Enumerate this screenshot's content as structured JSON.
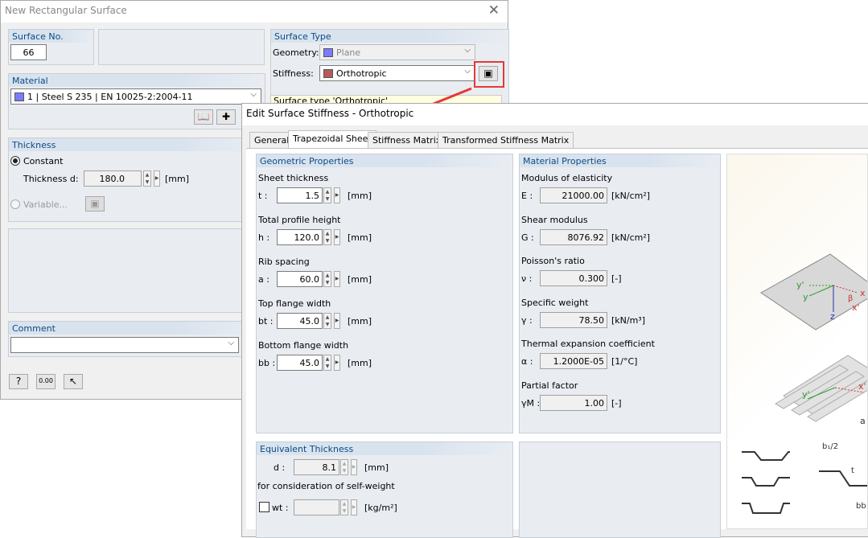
{
  "back": {
    "title": "New Rectangular Surface",
    "surface_no_label": "Surface No.",
    "surface_no": "66",
    "surface_type_label": "Surface Type",
    "geometry_label": "Geometry:",
    "geometry_value": "Plane",
    "stiffness_label": "Stiffness:",
    "stiffness_value": "Orthotropic",
    "info": "Surface type 'Orthotropic'",
    "material_label": "Material",
    "material_value": "1   |  Steel S 235  |  EN 10025-2:2004-11",
    "thickness_label": "Thickness",
    "constant_label": "Constant",
    "thickness_d_label": "Thickness d:",
    "thickness_d": "180.0",
    "thickness_unit": "[mm]",
    "variable_label": "Variable...",
    "comment_label": "Comment",
    "zero_btn": "0.00"
  },
  "front": {
    "title": "Edit Surface Stiffness - Orthotropic",
    "tabs": [
      "General",
      "Trapezoidal Sheet",
      "Stiffness Matrix",
      "Transformed Stiffness Matrix"
    ],
    "geom_head": "Geometric Properties",
    "geom": [
      {
        "label": "Sheet thickness",
        "sym": "t :",
        "value": "1.5",
        "unit": "[mm]"
      },
      {
        "label": "Total profile height",
        "sym": "h :",
        "value": "120.0",
        "unit": "[mm]"
      },
      {
        "label": "Rib spacing",
        "sym": "a :",
        "value": "60.0",
        "unit": "[mm]"
      },
      {
        "label": "Top flange width",
        "sym": "bt :",
        "value": "45.0",
        "unit": "[mm]"
      },
      {
        "label": "Bottom flange width",
        "sym": "bb :",
        "value": "45.0",
        "unit": "[mm]"
      }
    ],
    "mat_head": "Material Properties",
    "mat": [
      {
        "label": "Modulus of elasticity",
        "sym": "E :",
        "value": "21000.00",
        "unit": "[kN/cm²]"
      },
      {
        "label": "Shear modulus",
        "sym": "G :",
        "value": "8076.92",
        "unit": "[kN/cm²]"
      },
      {
        "label": "Poisson's ratio",
        "sym": "ν :",
        "value": "0.300",
        "unit": "[-]"
      },
      {
        "label": "Specific weight",
        "sym": "γ :",
        "value": "78.50",
        "unit": "[kN/m³]"
      },
      {
        "label": "Thermal expansion coefficient",
        "sym": "α :",
        "value": "1.2000E-05",
        "unit": "[1/°C]"
      },
      {
        "label": "Partial factor",
        "sym": "γM :",
        "value": "1.00",
        "unit": "[-]"
      }
    ],
    "eq_head": "Equivalent Thickness",
    "eq_d_sym": "d :",
    "eq_d": "8.1",
    "eq_d_unit": "[mm]",
    "selfweight_label": "for consideration of self-weight",
    "wt_label": "wt :",
    "wt_unit": "[kg/m²]",
    "diagram": {
      "labels": [
        "y'",
        "y",
        "x",
        "x'",
        "β",
        "z",
        "y'",
        "x'",
        "a",
        "b₁/2",
        "t",
        "bb"
      ]
    }
  },
  "colors": {
    "accent": "#0b4a86",
    "highlight": "#e53935"
  }
}
